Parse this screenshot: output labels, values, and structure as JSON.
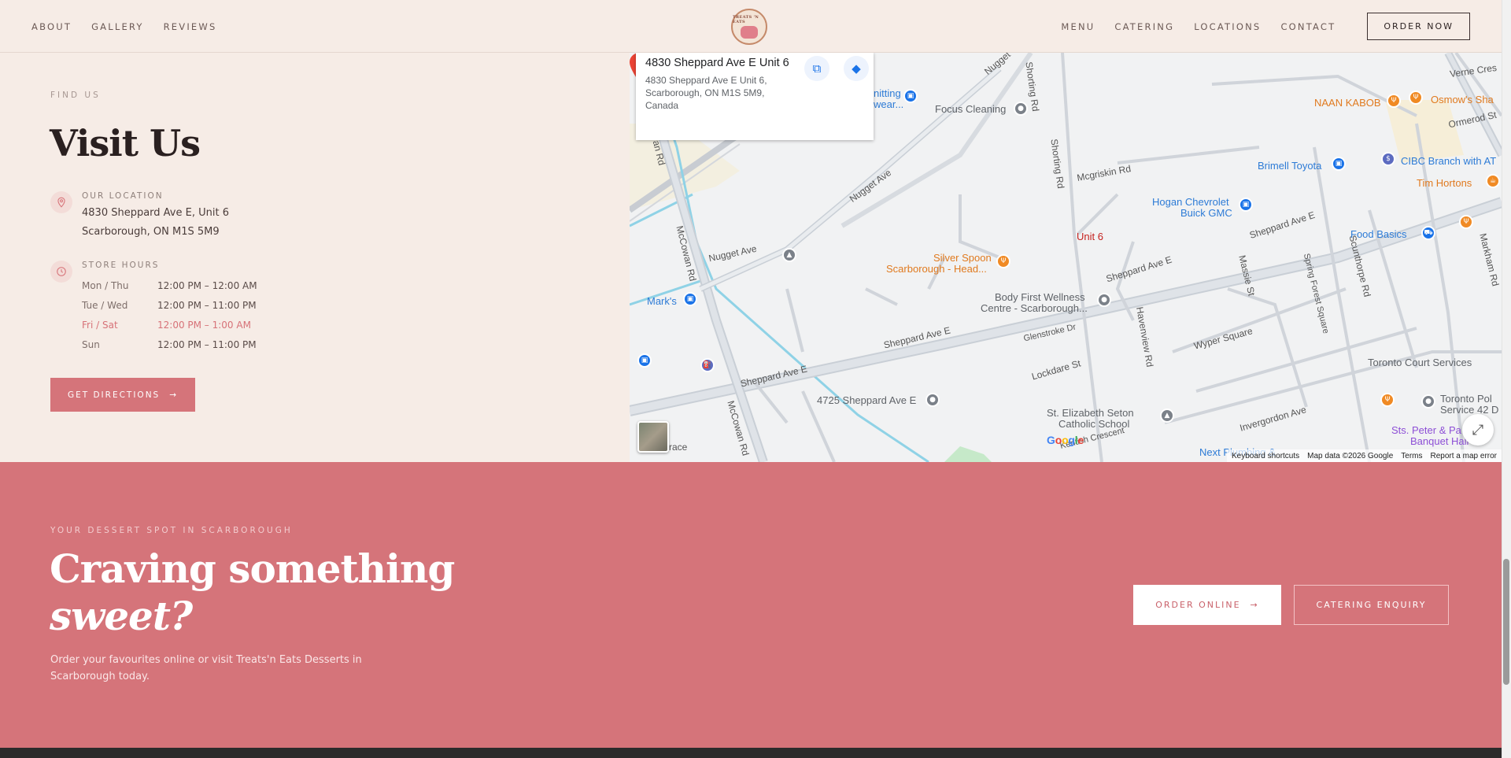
{
  "header": {
    "nav_left": [
      "ABOUT",
      "GALLERY",
      "REVIEWS"
    ],
    "nav_right": [
      "MENU",
      "CATERING",
      "LOCATIONS",
      "CONTACT"
    ],
    "order_now": "ORDER NOW",
    "logo_text": "TREATS 'N EATS"
  },
  "visit": {
    "eyebrow": "FIND US",
    "title": "Visit Us",
    "location_label": "OUR LOCATION",
    "address_line1": "4830 Sheppard Ave E, Unit 6",
    "address_line2": "Scarborough, ON M1S 5M9",
    "hours_label": "STORE HOURS",
    "hours": [
      {
        "day": "Mon / Thu",
        "time": "12:00 PM – 12:00 AM"
      },
      {
        "day": "Tue / Wed",
        "time": "12:00 PM – 11:00 PM"
      },
      {
        "day": "Fri / Sat",
        "time": "12:00 PM – 1:00 AM"
      },
      {
        "day": "Sun",
        "time": "12:00 PM – 11:00 PM"
      }
    ],
    "directions_button": "GET DIRECTIONS",
    "arrow": "→"
  },
  "map": {
    "card_title": "4830 Sheppard Ave E Unit 6",
    "card_address": "4830 Sheppard Ave E Unit 6, Scarborough, ON M1S 5M9, Canada",
    "pin_label": "Unit 6",
    "pois": {
      "focus_cleaning": "Focus Cleaning",
      "naan_kabob": "NAAN KABOB",
      "osmows": "Osmow's Sha",
      "brimell": "Brimell Toyota",
      "cibc": "CIBC Branch with AT",
      "tim": "Tim Hortons",
      "hogan1": "Hogan Chevrolet",
      "hogan2": "Buick GMC",
      "food_basics": "Food Basics",
      "silver1": "Silver Spoon",
      "silver2": "Scarborough - Head...",
      "body1": "Body First Wellness",
      "body2": "Centre - Scarborough...",
      "marks": "Mark's",
      "knitting1": "nitting",
      "knitting2": "wear...",
      "toronto_court": "Toronto Court Services",
      "toronto_pol1": "Toronto Pol",
      "toronto_pol2": "Service 42 D",
      "st_peter1": "Sts. Peter & Pa",
      "st_peter2": "Banquet Hall",
      "sheppard_4725": "4725 Sheppard Ave E",
      "st_eliz1": "St. Elizabeth Seton",
      "st_eliz2": "Catholic School",
      "next_plumbing": "Next Plumbing &"
    },
    "roads": {
      "nugget1": "Nugget Ave",
      "nugget2": "Nugget Ave",
      "nugget3": "Nugget",
      "shorting1": "Shorting Rd",
      "shorting2": "Shorting Rd",
      "mcgriskin": "Mcgriskin Rd",
      "mccowan1": "McCowan Rd",
      "mccowan2": "McCowan Rd",
      "mccowan3": "wan Rd",
      "sheppard1": "Sheppard Ave E",
      "sheppard2": "Sheppard Ave E",
      "sheppard3": "Sheppard Ave E",
      "sheppard4": "Sheppard Ave E",
      "glenstroke": "Glenstroke Dr",
      "lockdare": "Lockdare St",
      "havenview": "Havenview Rd",
      "massie": "Massie St",
      "spring_forest": "Spring Forest Square",
      "scunthorpe": "Scunthorpe Rd",
      "markham": "Markham Rd",
      "wyper": "Wyper Square",
      "invergordon": "Invergordon Ave",
      "kentish": "Kentish Crescent",
      "ormerod": "Ormerod St",
      "verne": "Verne Cres",
      "race": "race"
    },
    "google": "Google",
    "footer": [
      "Keyboard shortcuts",
      "Map data ©2026 Google",
      "Terms",
      "Report a map error"
    ]
  },
  "cta": {
    "eyebrow": "YOUR DESSERT SPOT IN SCARBOROUGH",
    "title_line1": "Craving something",
    "title_line2": "sweet?",
    "description": "Order your favourites online or visit Treats'n Eats Desserts in Scarborough today.",
    "order_online": "ORDER ONLINE",
    "catering_enquiry": "CATERING ENQUIRY",
    "arrow": "→"
  },
  "colors": {
    "cream": "#f6ece6",
    "rose": "#d5747a",
    "dark": "#2a2020"
  }
}
